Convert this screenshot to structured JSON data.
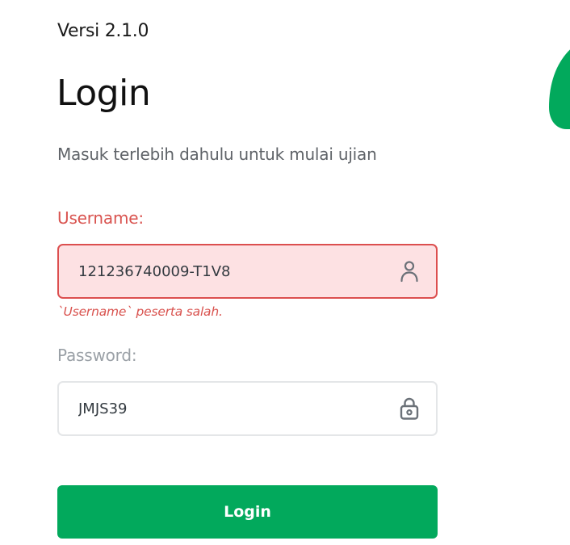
{
  "app": {
    "version": "Versi 2.1.0"
  },
  "login": {
    "title": "Login",
    "subtitle": "Masuk terlebih dahulu untuk mulai ujian",
    "username": {
      "label": "Username:",
      "value": "121236740009-T1V8",
      "error": "`Username` peserta salah.",
      "icon": "user-icon"
    },
    "password": {
      "label": "Password:",
      "value": "JMJS39",
      "icon": "lock-icon"
    },
    "submit_label": "Login"
  },
  "colors": {
    "accent": "#02a95c",
    "error": "#dc4f4f",
    "error_bg": "#fde1e3"
  }
}
